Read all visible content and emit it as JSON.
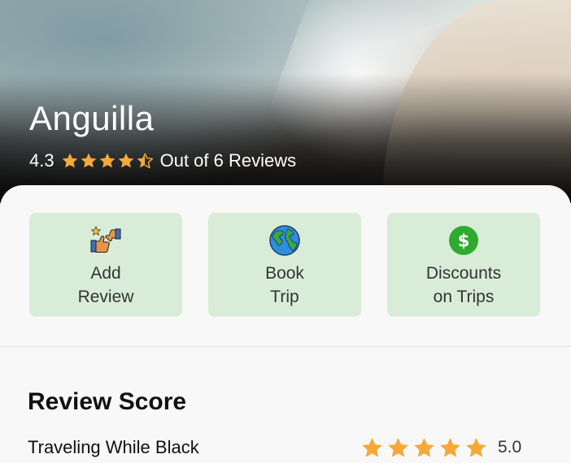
{
  "hero": {
    "place": "Anguilla",
    "rating": "4.3",
    "rating_stars": 4.3,
    "reviews_text": "Out of 6 Reviews"
  },
  "actions": [
    {
      "line1": "Add",
      "line2": "Review",
      "icon": "thumbs-review-icon"
    },
    {
      "line1": "Book",
      "line2": "Trip",
      "icon": "globe-icon"
    },
    {
      "line1": "Discounts",
      "line2": "on Trips",
      "icon": "dollar-coin-icon"
    }
  ],
  "review_score": {
    "title": "Review Score",
    "items": [
      {
        "label": "Traveling While Black",
        "value": "5.0",
        "stars": 5
      }
    ]
  },
  "colors": {
    "star": "#f5a93a",
    "card_bg": "#d9ecd8",
    "globe_green": "#3aa84a",
    "globe_blue": "#2f8de0",
    "coin_green": "#2eab2e"
  }
}
